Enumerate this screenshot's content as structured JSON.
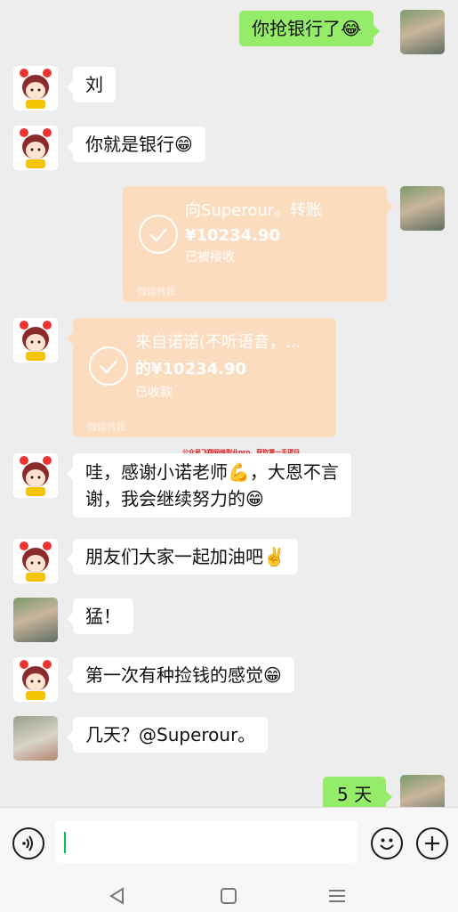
{
  "messages": [
    {
      "side": "out",
      "text": "你抢银行了",
      "emoji": "😂"
    },
    {
      "side": "in",
      "avatar": "girl",
      "text": "刘"
    },
    {
      "side": "in",
      "avatar": "girl",
      "text": "你就是银行",
      "emoji": "😁"
    },
    {
      "side": "out",
      "type": "transfer",
      "title": "向Superour。转账",
      "amount": "¥10234.90",
      "status": "已被接收",
      "footer": "微信转账"
    },
    {
      "side": "in",
      "avatar": "girl",
      "type": "transfer",
      "title": "来自诺诺(不听语音，...",
      "amount": "的¥10234.90",
      "status": "已收款",
      "footer": "微信转账"
    },
    {
      "side": "in",
      "avatar": "girl",
      "line1": "哇，感谢小诺老师",
      "line1_emoji": "💪",
      "line1_end": "，大恩不言",
      "line2": "谢，我会继续努力的",
      "line2_emoji": "😁"
    },
    {
      "side": "in",
      "avatar": "girl",
      "text": "朋友们大家一起加油吧",
      "emoji": "✌️"
    },
    {
      "side": "in",
      "avatar": "photo",
      "text": "猛！"
    },
    {
      "side": "in",
      "avatar": "girl",
      "text": "第一次有种捡钱的感觉",
      "emoji": "😁"
    },
    {
      "side": "in",
      "avatar": "grey",
      "text": "几天？@Superour。"
    },
    {
      "side": "out",
      "text": "5 天"
    }
  ],
  "watermark": "公众号飞翔网络副业pro，获取第一手项目",
  "input_bar": {
    "voice_icon": "voice-icon",
    "emoji_icon": "emoji-icon",
    "add_icon": "plus-icon",
    "input_value": ""
  },
  "nav_bar": {
    "back_icon": "back-icon",
    "home_icon": "home-icon",
    "menu_icon": "menu-icon"
  },
  "colors": {
    "background": "#ededed",
    "outgoing_bubble": "#95ec69",
    "incoming_bubble": "#ffffff",
    "transfer_bubble": "#fbdcbf",
    "caret": "#07c160",
    "watermark": "#e0181a"
  }
}
